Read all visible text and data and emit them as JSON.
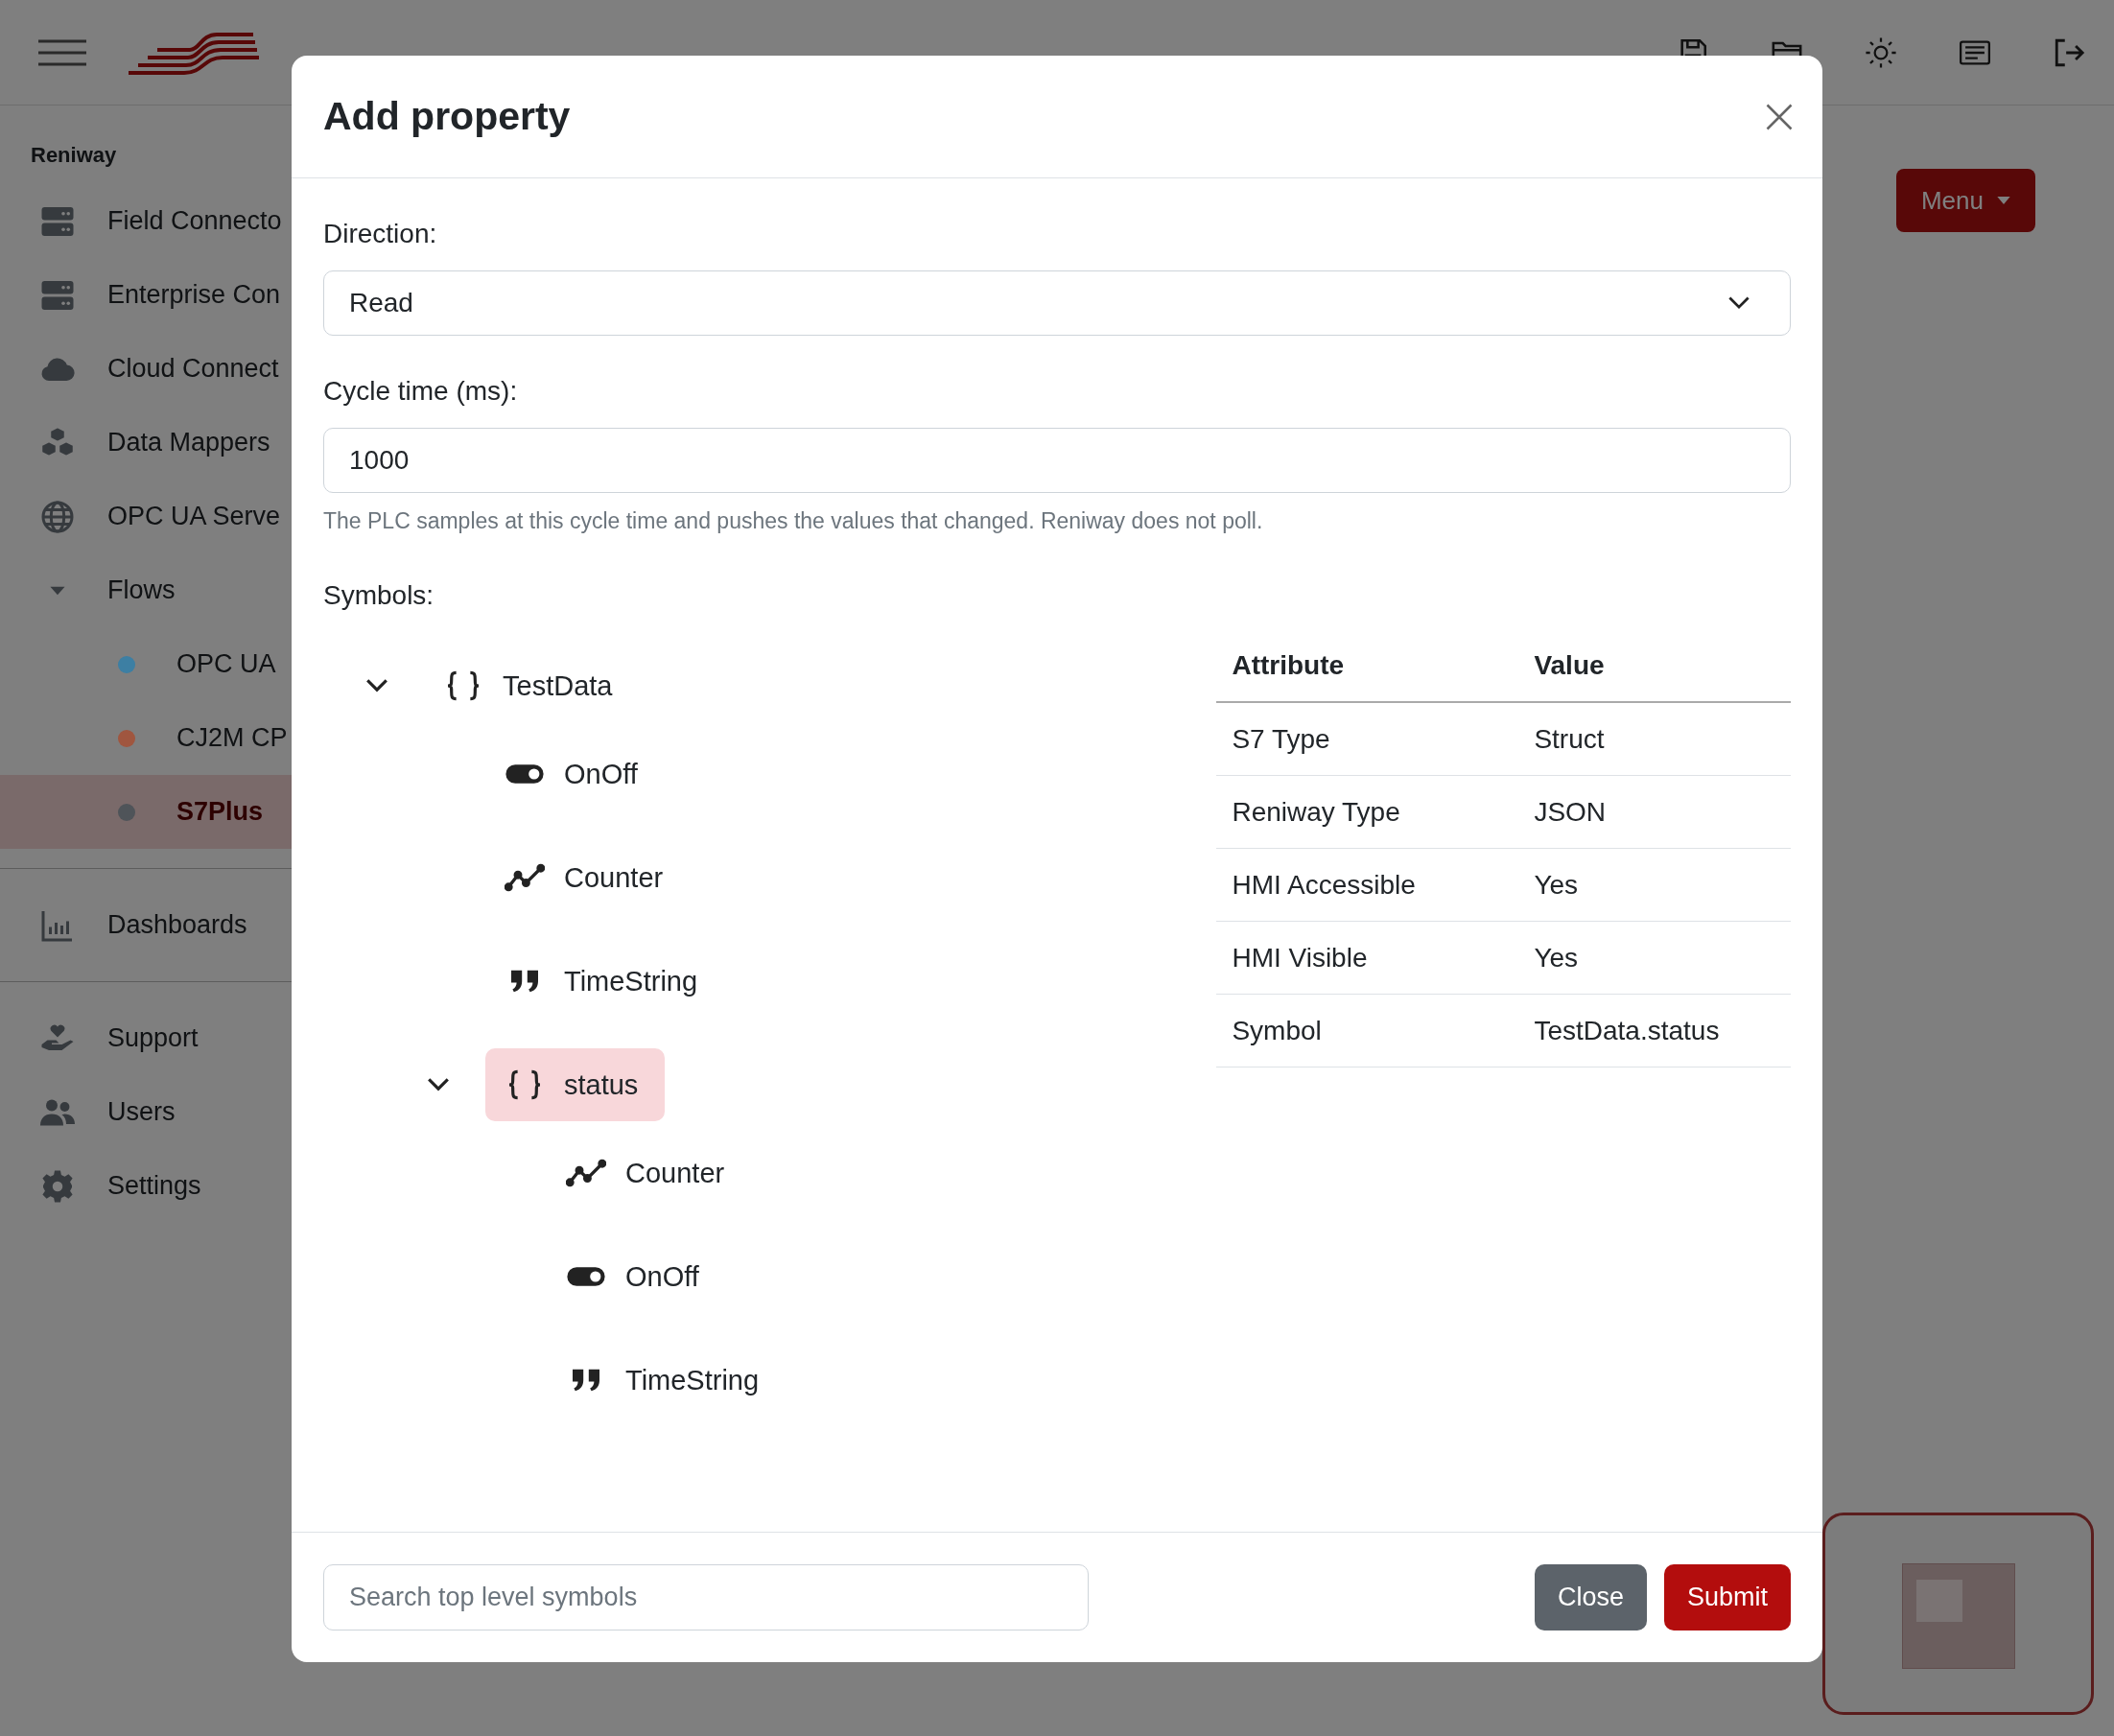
{
  "sidebar": {
    "heading": "Reniway",
    "groups": [
      [
        {
          "label": "Field Connecto",
          "kind": "server"
        },
        {
          "label": "Enterprise Con",
          "kind": "server"
        },
        {
          "label": "Cloud Connect",
          "kind": "cloud"
        },
        {
          "label": "Data Mappers",
          "kind": "boxes"
        },
        {
          "label": "OPC UA Serve",
          "kind": "globe"
        },
        {
          "label": "Flows",
          "kind": "folder",
          "expanded": true,
          "children": [
            {
              "label": "OPC UA",
              "color": "#3d7fa3",
              "selected": false
            },
            {
              "label": "CJ2M CP",
              "color": "#a0563f",
              "selected": false
            },
            {
              "label": "S7Plus",
              "color": "#4f5459",
              "selected": true
            }
          ]
        }
      ],
      [
        {
          "label": "Dashboards",
          "kind": "chart"
        }
      ],
      [
        {
          "label": "Support",
          "kind": "support"
        },
        {
          "label": "Users",
          "kind": "users"
        },
        {
          "label": "Settings",
          "kind": "gear"
        }
      ]
    ]
  },
  "main": {
    "menu_button": "Menu"
  },
  "dialog": {
    "title": "Add property",
    "direction": {
      "label": "Direction:",
      "value": "Read"
    },
    "cycle_time": {
      "label": "Cycle time (ms):",
      "value": "1000",
      "help": "The PLC samples at this cycle time and pushes the values that changed. Reniway does not poll."
    },
    "symbols": {
      "label": "Symbols:",
      "tree": [
        {
          "label": "TestData",
          "kind": "struct",
          "expanded": true,
          "selected": false,
          "children": [
            {
              "label": "OnOff",
              "kind": "bool",
              "selected": false
            },
            {
              "label": "Counter",
              "kind": "number",
              "selected": false
            },
            {
              "label": "TimeString",
              "kind": "string",
              "selected": false
            },
            {
              "label": "status",
              "kind": "struct",
              "expanded": true,
              "selected": true,
              "children": [
                {
                  "label": "Counter",
                  "kind": "number",
                  "selected": false
                },
                {
                  "label": "OnOff",
                  "kind": "bool",
                  "selected": false
                },
                {
                  "label": "TimeString",
                  "kind": "string",
                  "selected": false
                }
              ]
            }
          ]
        }
      ]
    },
    "attributes": {
      "columns": [
        "Attribute",
        "Value"
      ],
      "rows": [
        [
          "S7 Type",
          "Struct"
        ],
        [
          "Reniway Type",
          "JSON"
        ],
        [
          "HMI Accessible",
          "Yes"
        ],
        [
          "HMI Visible",
          "Yes"
        ],
        [
          "Symbol",
          "TestData.status"
        ]
      ]
    },
    "search": {
      "placeholder": "Search top level symbols"
    },
    "buttons": [
      {
        "label": "Close",
        "kind": "secondary"
      },
      {
        "label": "Submit",
        "kind": "primary"
      }
    ]
  }
}
